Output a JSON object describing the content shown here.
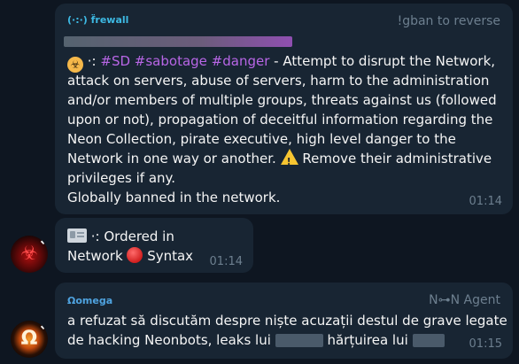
{
  "messages": [
    {
      "sender": "(·:·) f̈rewall",
      "role": "!gban to reverse",
      "sender_color": "#3db9e3",
      "tags": "#SD #sabotage #danger",
      "tag_prefix": "·:",
      "line1_rest": " - Attempt to disrupt the Network,",
      "lines": [
        "attack on servers, abuse of servers, harm to the administration",
        "and/or members of multiple groups, threats against us (followed",
        "upon or not), propagation of deceitful information regarding the",
        "Neon Collection, pirate executive, high level danger to the"
      ],
      "line_warn_before": "Network in one way or another.",
      "line_warn_after": "Remove their administrative",
      "line_privileges": "privileges if any.",
      "line_banned": "Globally banned in the network.",
      "time": "01:14",
      "emoji_bio": "biohazard-icon",
      "emoji_warn": "warning-icon"
    },
    {
      "line1": "·: Ordered in",
      "line2_a": "Network",
      "line2_b": "Syntax",
      "time": "01:14",
      "emoji_id": "id-card-icon",
      "emoji_red": "red-circle-icon"
    },
    {
      "sender": "Ωomega",
      "role": "N⊶N  Agent",
      "sender_color": "#4fa3e0",
      "line1": "a refuzat să discutăm despre niște acuzații destul de grave legate",
      "line2_a": "de hacking Neonbots, leaks lui",
      "line2_b": "hărțuirea lui",
      "time": "01:15"
    }
  ],
  "avatars": {
    "first": "biohazard-avatar",
    "second": "omega-avatar"
  },
  "colors": {
    "background": "#0e1621",
    "bubble": "#182533",
    "tag": "#b866e6",
    "muted": "#6d7f8f"
  }
}
